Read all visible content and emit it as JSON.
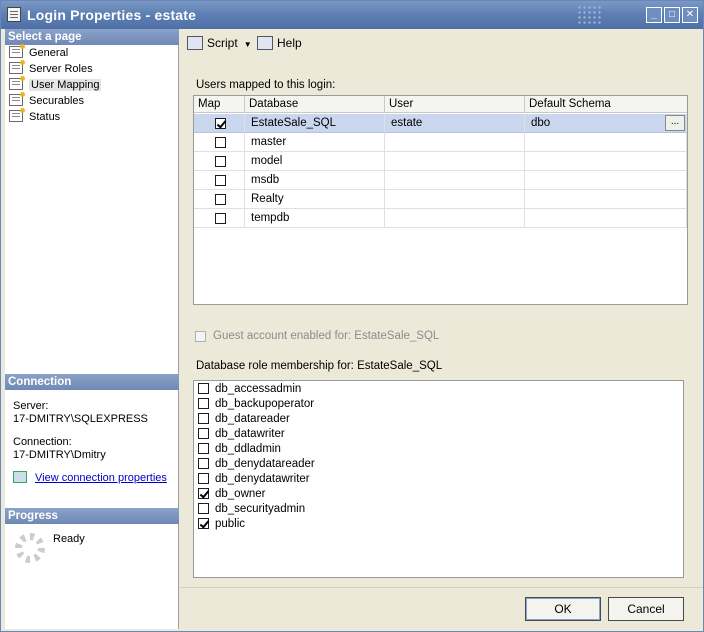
{
  "window": {
    "title": "Login Properties - estate"
  },
  "left": {
    "select_page_header": "Select a page",
    "items": [
      {
        "label": "General",
        "selected": false
      },
      {
        "label": "Server Roles",
        "selected": false
      },
      {
        "label": "User Mapping",
        "selected": true
      },
      {
        "label": "Securables",
        "selected": false
      },
      {
        "label": "Status",
        "selected": false
      }
    ],
    "connection_header": "Connection",
    "server_label": "Server:",
    "server_value": "17-DMITRY\\SQLEXPRESS",
    "connection_label": "Connection:",
    "connection_value": "17-DMITRY\\Dmitry",
    "view_props_link": "View connection properties",
    "progress_header": "Progress",
    "progress_status": "Ready"
  },
  "toolbar": {
    "script_label": "Script",
    "help_label": "Help"
  },
  "main": {
    "users_mapped_label": "Users mapped to this login:",
    "columns": [
      "Map",
      "Database",
      "User",
      "Default Schema"
    ],
    "rows": [
      {
        "map": true,
        "database": "EstateSale_SQL",
        "user": "estate",
        "schema": "dbo",
        "selected": true
      },
      {
        "map": false,
        "database": "master",
        "user": "",
        "schema": "",
        "selected": false
      },
      {
        "map": false,
        "database": "model",
        "user": "",
        "schema": "",
        "selected": false
      },
      {
        "map": false,
        "database": "msdb",
        "user": "",
        "schema": "",
        "selected": false
      },
      {
        "map": false,
        "database": "Realty",
        "user": "",
        "schema": "",
        "selected": false
      },
      {
        "map": false,
        "database": "tempdb",
        "user": "",
        "schema": "",
        "selected": false
      }
    ],
    "ellipsis_label": "...",
    "guest_label": "Guest account enabled for: EstateSale_SQL",
    "role_membership_label": "Database role membership for: EstateSale_SQL",
    "roles": [
      {
        "name": "db_accessadmin",
        "checked": false
      },
      {
        "name": "db_backupoperator",
        "checked": false
      },
      {
        "name": "db_datareader",
        "checked": false
      },
      {
        "name": "db_datawriter",
        "checked": false
      },
      {
        "name": "db_ddladmin",
        "checked": false
      },
      {
        "name": "db_denydatareader",
        "checked": false
      },
      {
        "name": "db_denydatawriter",
        "checked": false
      },
      {
        "name": "db_owner",
        "checked": true
      },
      {
        "name": "db_securityadmin",
        "checked": false
      },
      {
        "name": "public",
        "checked": true
      }
    ]
  },
  "footer": {
    "ok_label": "OK",
    "cancel_label": "Cancel"
  }
}
